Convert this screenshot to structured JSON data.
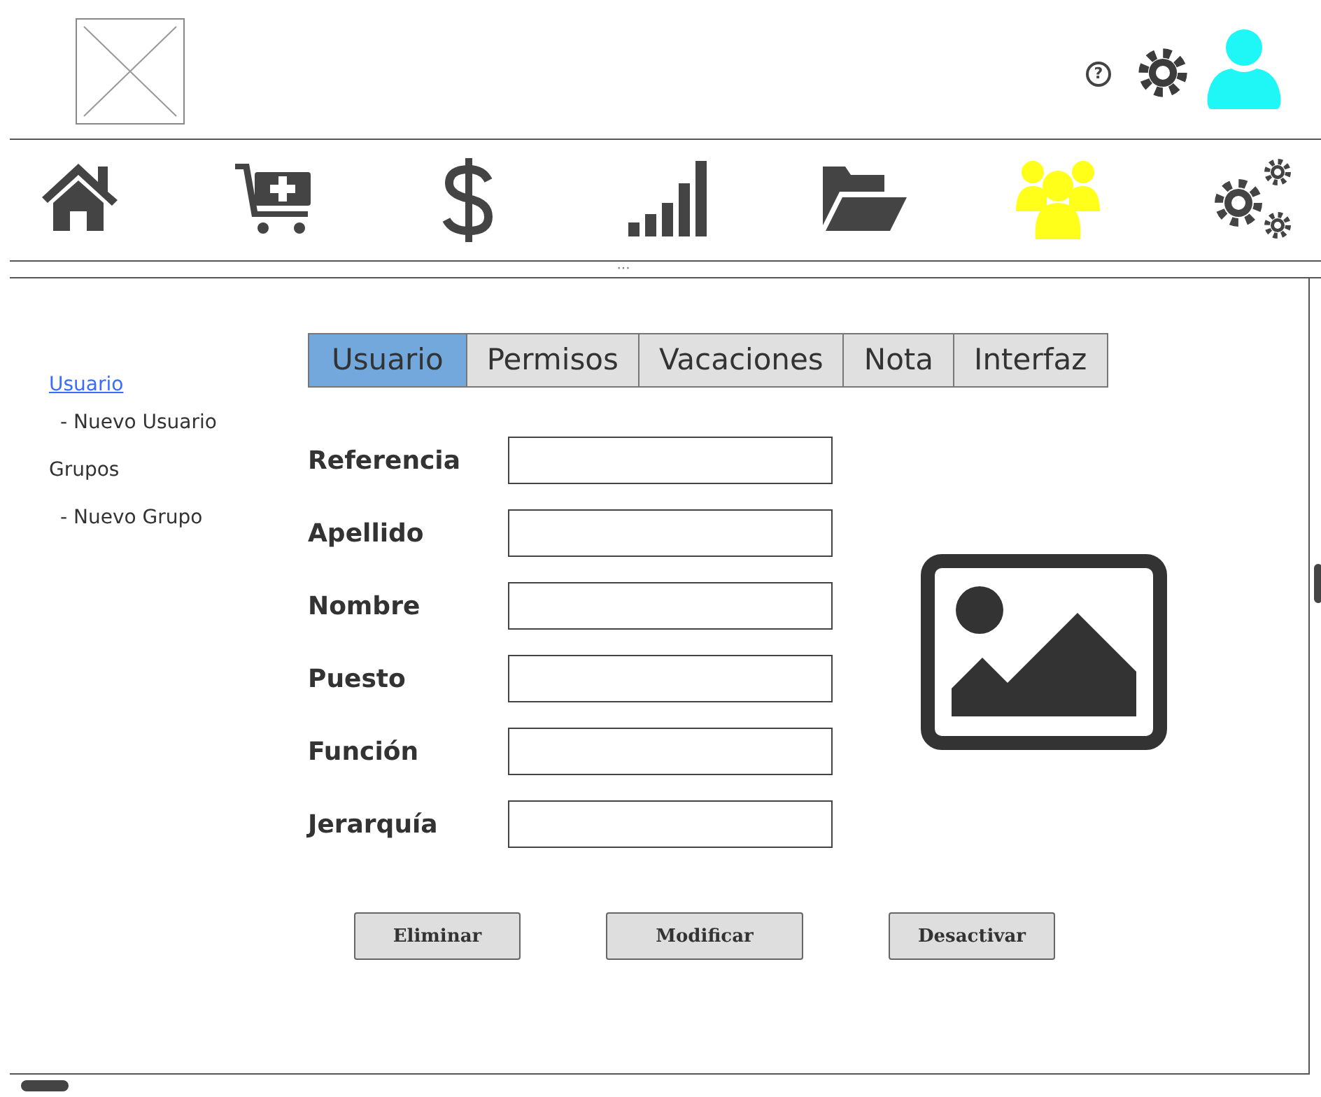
{
  "nav": [
    {
      "kind": "home",
      "selected": false
    },
    {
      "kind": "cart",
      "selected": false
    },
    {
      "kind": "dollar",
      "selected": false
    },
    {
      "kind": "chart",
      "selected": false
    },
    {
      "kind": "folder",
      "selected": false
    },
    {
      "kind": "group",
      "selected": true
    },
    {
      "kind": "gears",
      "selected": false
    }
  ],
  "header_help": "?",
  "toolbar_grip": "···",
  "sidebar": {
    "items": [
      {
        "label": "Usuario",
        "kind": "link",
        "children": [
          {
            "label": "- Nuevo Usuario"
          }
        ]
      },
      {
        "label": "Grupos",
        "kind": "text",
        "children": [
          {
            "label": "- Nuevo Grupo"
          }
        ]
      }
    ]
  },
  "tabs": [
    {
      "label": "Usuario",
      "selected": true
    },
    {
      "label": "Permisos",
      "selected": false
    },
    {
      "label": "Vacaciones",
      "selected": false
    },
    {
      "label": "Nota",
      "selected": false
    },
    {
      "label": "Interfaz",
      "selected": false
    }
  ],
  "fields": [
    {
      "label": "Referencia"
    },
    {
      "label": "Apellido"
    },
    {
      "label": "Nombre"
    },
    {
      "label": "Puesto"
    },
    {
      "label": "Función"
    },
    {
      "label": "Jerarquía"
    }
  ],
  "buttons": [
    "Eliminar",
    "Modificar",
    "Desactivar"
  ]
}
